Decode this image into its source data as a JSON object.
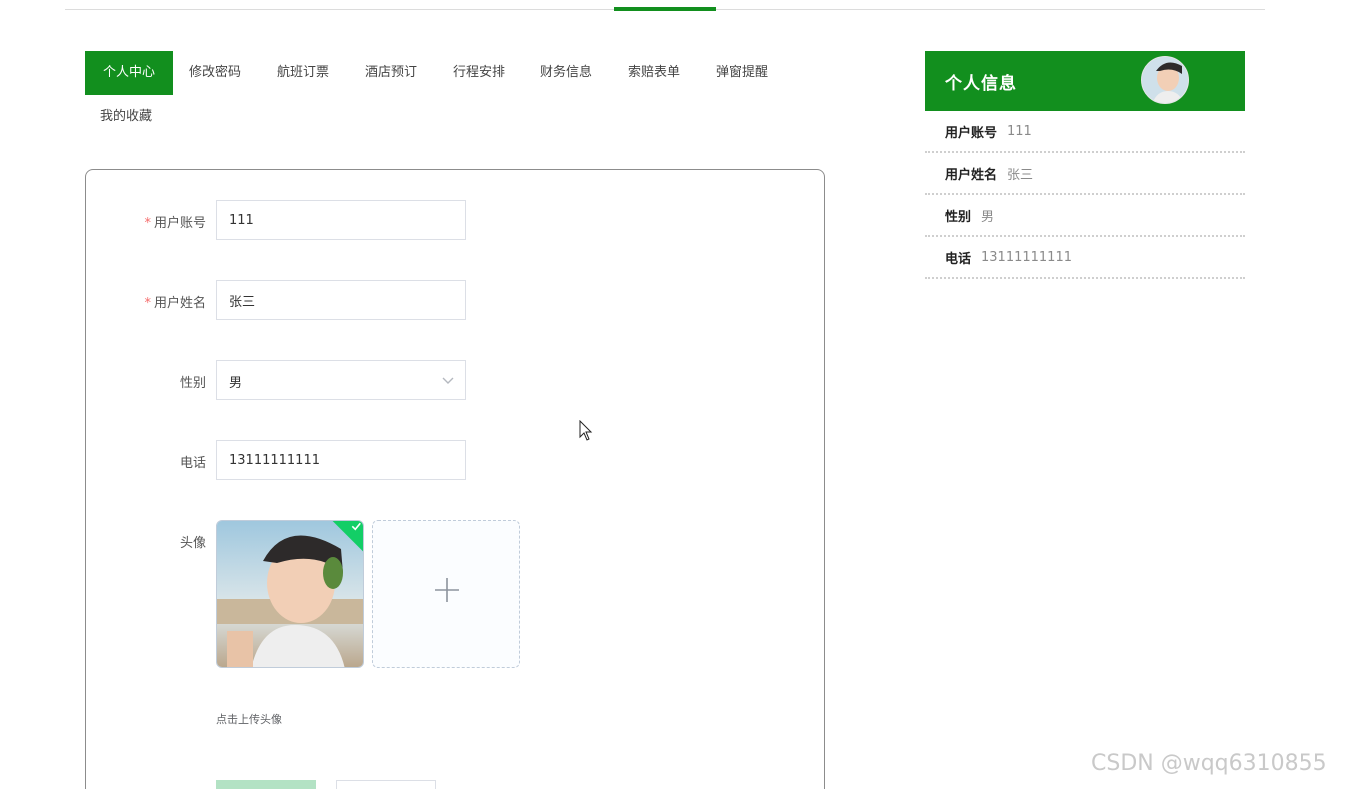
{
  "tabs": [
    {
      "label": "个人中心",
      "active": true
    },
    {
      "label": "修改密码"
    },
    {
      "label": "航班订票"
    },
    {
      "label": "酒店预订"
    },
    {
      "label": "行程安排"
    },
    {
      "label": "财务信息"
    },
    {
      "label": "索赔表单"
    },
    {
      "label": "弹窗提醒"
    },
    {
      "label": "我的收藏"
    }
  ],
  "form": {
    "required_mark": "*",
    "account": {
      "label": "用户账号",
      "value": "111"
    },
    "name": {
      "label": "用户姓名",
      "value": "张三"
    },
    "gender": {
      "label": "性别",
      "value": "男"
    },
    "phone": {
      "label": "电话",
      "value": "13111111111"
    },
    "avatar": {
      "label": "头像",
      "tip": "点击上传头像"
    }
  },
  "side": {
    "title": "个人信息",
    "rows": [
      {
        "label": "用户账号",
        "value": "111"
      },
      {
        "label": "用户姓名",
        "value": "张三"
      },
      {
        "label": "性别",
        "value": "男"
      },
      {
        "label": "电话",
        "value": "13111111111"
      }
    ]
  },
  "watermark": "CSDN @wqq6310855",
  "colors": {
    "primary": "#128f1e",
    "success": "#13ce66",
    "required": "#f56c6c"
  }
}
